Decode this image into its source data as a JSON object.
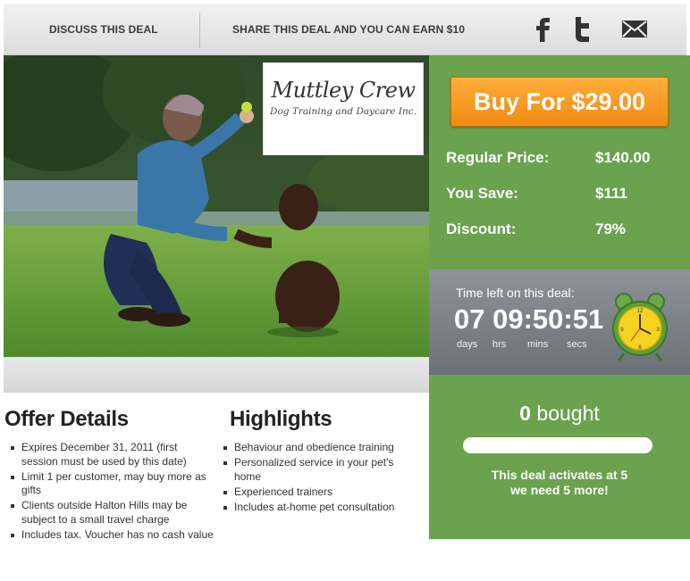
{
  "header": {
    "discuss_label": "DISCUSS THIS DEAL",
    "share_label": "SHARE THIS DEAL AND YOU CAN EARN $10",
    "social": [
      "facebook-icon",
      "twitter-icon",
      "mail-icon"
    ]
  },
  "hero": {
    "logo_title": "Muttley Crew",
    "logo_subtitle": "Dog Training and Daycare Inc."
  },
  "buy": {
    "button_label": "Buy For $29.00",
    "rows": [
      {
        "label": "Regular Price:",
        "value": "$140.00"
      },
      {
        "label": "You Save:",
        "value": "$111"
      },
      {
        "label": "Discount:",
        "value": "79%"
      }
    ]
  },
  "timer": {
    "label": "Time left on this deal:",
    "days": "07",
    "hrs": "09",
    "mins": "50",
    "secs": "51",
    "units": {
      "days": "days",
      "hrs": "hrs",
      "mins": "mins",
      "secs": "secs"
    }
  },
  "bought": {
    "count": "0",
    "label": " bought",
    "progress": 0,
    "activation_line1": "This deal activates at 5",
    "activation_line2": "we need 5 more!"
  },
  "offer_details": {
    "title": "Offer Details",
    "items": [
      "Expires December 31, 2011 (first session must be used by this date)",
      "Limit 1 per customer, may buy more as gifts",
      "Clients outside Halton Hills may be subject to a small travel charge",
      "Includes tax. Voucher has no cash value"
    ]
  },
  "highlights": {
    "title": "Highlights",
    "items": [
      "Behaviour and obedience training",
      "Personalized service in your pet's home",
      "Experienced trainers",
      "Includes at-home pet consultation"
    ]
  },
  "colors": {
    "green": "#6aa24e",
    "orange": "#f08a12",
    "timer_gray": "#7d8288"
  }
}
